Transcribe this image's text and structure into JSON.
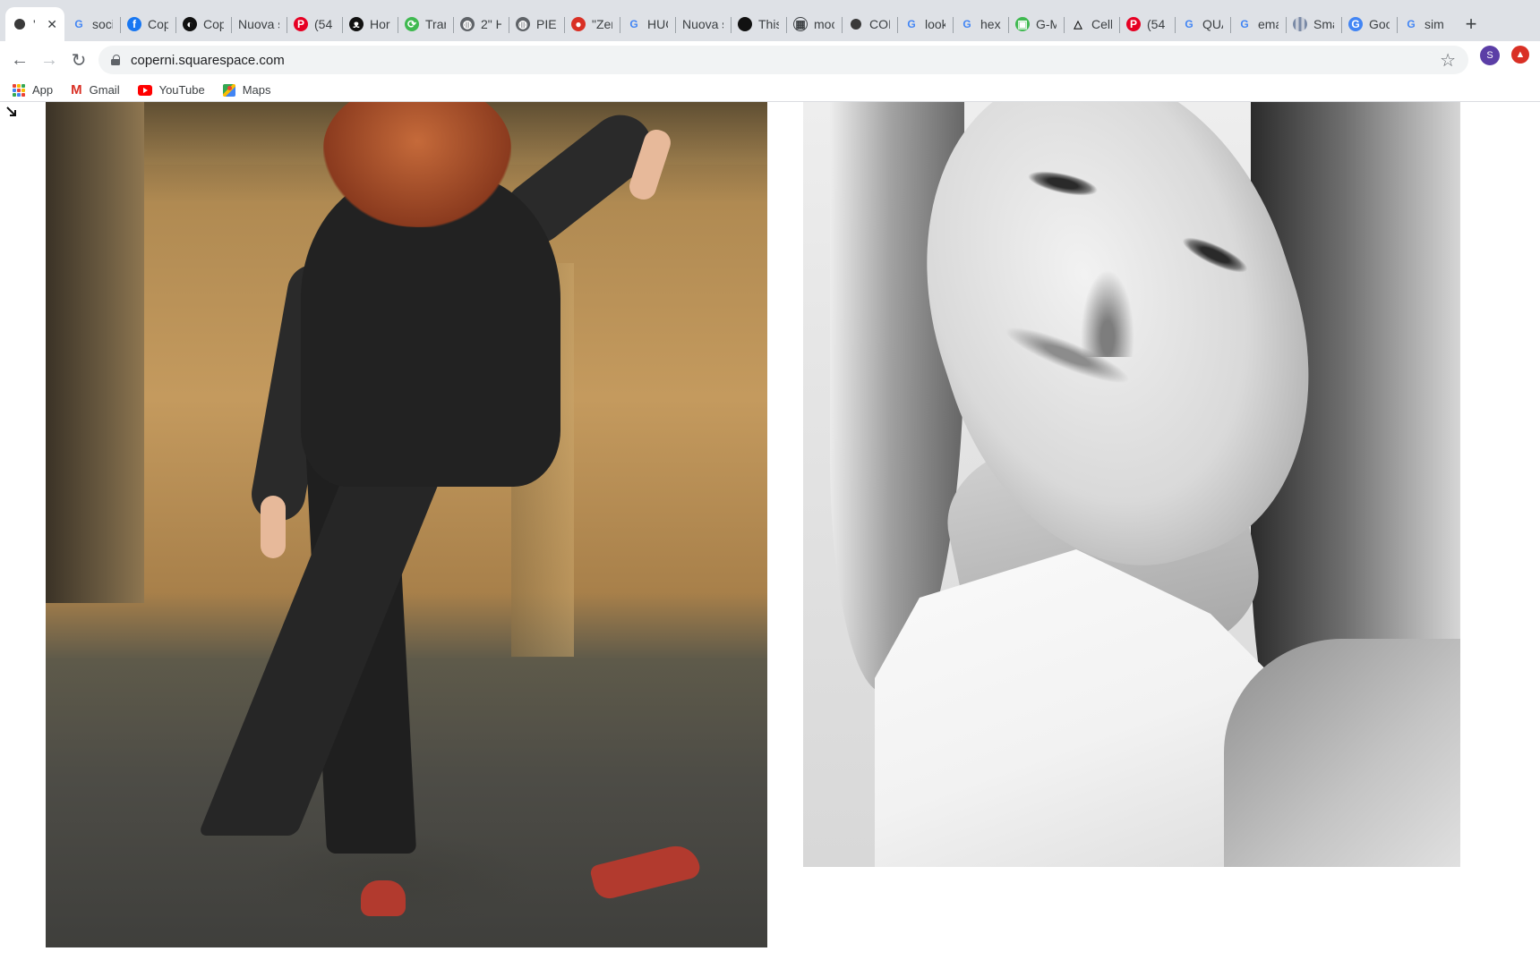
{
  "browser": {
    "tabs": [
      {
        "title": "'",
        "icon": "cube-favicon-icon",
        "active": true
      },
      {
        "title": "soci",
        "icon": "google-icon"
      },
      {
        "title": "Cop",
        "icon": "facebook-icon"
      },
      {
        "title": "Cop",
        "icon": "swirl-icon"
      },
      {
        "title": "Nuova s",
        "icon": ""
      },
      {
        "title": "(54",
        "icon": "pinterest-icon"
      },
      {
        "title": "Hor",
        "icon": "claw-icon"
      },
      {
        "title": "Trar",
        "icon": "translate-icon"
      },
      {
        "title": "2\" H",
        "icon": "globe-icon"
      },
      {
        "title": "PIET",
        "icon": "globe-icon"
      },
      {
        "title": "\"Zer",
        "icon": "record-icon"
      },
      {
        "title": "HUG",
        "icon": "google-icon"
      },
      {
        "title": "Nuova s",
        "icon": ""
      },
      {
        "title": "This",
        "icon": "black-square-icon"
      },
      {
        "title": "moc",
        "icon": "box-icon"
      },
      {
        "title": "COI",
        "icon": "cube-favicon-icon"
      },
      {
        "title": "look",
        "icon": "google-icon"
      },
      {
        "title": "hex",
        "icon": "google-icon"
      },
      {
        "title": "G-M",
        "icon": "green-app-icon"
      },
      {
        "title": "Cell",
        "icon": "triangle-icon"
      },
      {
        "title": "(54",
        "icon": "pinterest-icon"
      },
      {
        "title": "QUA",
        "icon": "google-icon"
      },
      {
        "title": "ema",
        "icon": "google-icon"
      },
      {
        "title": "Sma",
        "icon": "bars-icon"
      },
      {
        "title": "Goo",
        "icon": "translate-icon"
      },
      {
        "title": "sim",
        "icon": "google-icon"
      }
    ],
    "new_tab_label": "+",
    "url": "coperni.squarespace.com",
    "profile_initial": "S",
    "bookmarks": [
      {
        "label": "App",
        "icon": "apps-grid-icon"
      },
      {
        "label": "Gmail",
        "icon": "gmail-icon"
      },
      {
        "label": "YouTube",
        "icon": "youtube-icon"
      },
      {
        "label": "Maps",
        "icon": "maps-icon"
      }
    ]
  },
  "colors": {
    "tabstrip_bg": "#dee1e6",
    "omnibox_bg": "#f1f3f4",
    "profile_bg": "#5b3ea6",
    "extension_bg": "#d93025"
  }
}
